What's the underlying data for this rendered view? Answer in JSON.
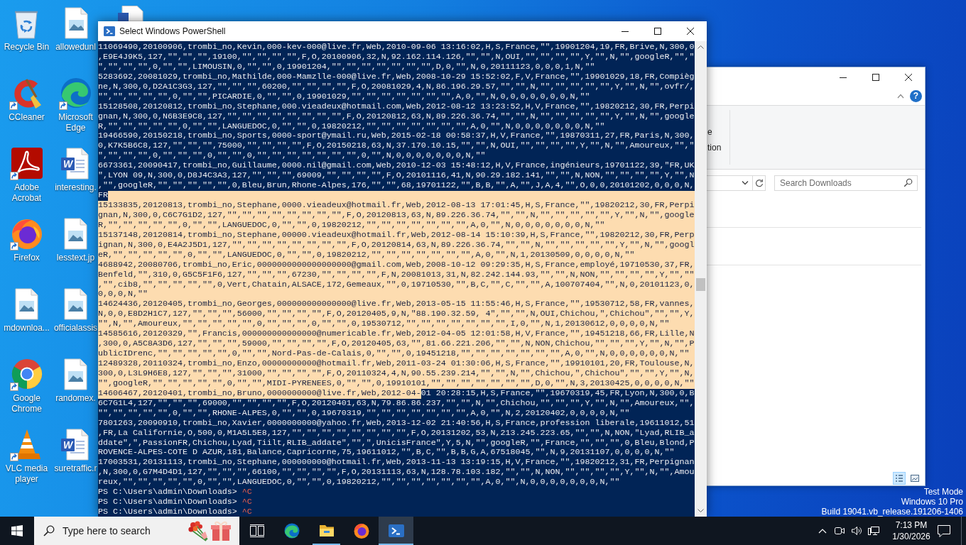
{
  "desktop": {
    "icons": [
      {
        "label": "Recycle Bin",
        "kind": "recycle-bin",
        "shortcut": false
      },
      {
        "label": "CCleaner",
        "kind": "ccleaner",
        "shortcut": true
      },
      {
        "label": "Adobe Acrobat",
        "kind": "acrobat",
        "shortcut": true
      },
      {
        "label": "Firefox",
        "kind": "firefox",
        "shortcut": true
      },
      {
        "label": "mdownloa...",
        "kind": "image",
        "shortcut": false
      },
      {
        "label": "Google Chrome",
        "kind": "chrome",
        "shortcut": true
      },
      {
        "label": "VLC media player",
        "kind": "vlc",
        "shortcut": true
      },
      {
        "label": "allowedunl",
        "kind": "image",
        "shortcut": false
      },
      {
        "label": "Microsoft Edge",
        "kind": "edge",
        "shortcut": true
      },
      {
        "label": "interesting.",
        "kind": "word",
        "logo_letter": "W",
        "shortcut": false
      },
      {
        "label": "lesstext.jp",
        "kind": "image",
        "shortcut": false
      },
      {
        "label": "officialassis",
        "kind": "image",
        "shortcut": false
      },
      {
        "label": "randomex.",
        "kind": "image",
        "shortcut": false
      },
      {
        "label": "suretraffic.r",
        "kind": "word",
        "logo_letter": "W",
        "shortcut": false
      }
    ]
  },
  "powershell": {
    "title": "Select Windows PowerShell",
    "rows": [
      {
        "kind": "output",
        "selected": false,
        "text": "11069490,20100906,trombi_no,Kevin,000-kev-000@live.fr,Web,2010-09-06 13:16:02,H,S,France,\"\",19901204,19,FR,Brive,N,300,0"
      },
      {
        "kind": "output",
        "selected": false,
        "text": ",E9E4J9K5,127,\"\",\"\",\"\",19100,\"\",\"\",\"\",\"\",F,O,20100906,32,N,92.162.114.126,\"\",\"\",N,OUI,\"\",\"\",\"\",\"\",Y,\"\",N,\"\",googleR,\"\",\""
      },
      {
        "kind": "output",
        "selected": false,
        "text": "\",\"\",\"\",\"\",0,\"\",\"\",LIMOUSIN,0,\"\",\"\",0,19901204,\"\",\"\",\"\",\"\",\"\",\"\",\"\",D,0,\"\",N,0,20111123,0,0,0,1,N,\"\""
      },
      {
        "kind": "output",
        "selected": false,
        "text": "5283692,20081029,trombi_no,Mathilde,000-Mamzlle-000@live.fr,Web,2008-10-29 15:52:02,F,V,France,\"\",19901029,18,FR,Compièg"
      },
      {
        "kind": "output",
        "selected": false,
        "text": "ne,N,300,0,D2A1C3G3,127,\"\",\"\",\"\",60200,\"\",\"\",\"\",\"\",F,O,20081029,4,N,86.196.29.57,\"\",\"\",N,\"\",\"\",\"\",\"\",\"\",Y,\"\",N,\"\",ovfr/,"
      },
      {
        "kind": "output",
        "selected": false,
        "text": "\"\",\"\",\"\",\"\",\"\",0,\"\",\"\",PICARDIE,0,\"\",\"\",0,19901029,\"\",\"\",\"\",\"\",\"\",\"\",\"\",A,0,\"\",N,0,0,0,0,0,0,0,N,\"\""
      },
      {
        "kind": "output",
        "selected": false,
        "text": "15128508,20120812,trombi_no,Stephane,000.vieadeux@hotmail.com,Web,2012-08-12 13:23:52,H,V,France,\"\",19820212,30,FR,Perpi"
      },
      {
        "kind": "output",
        "selected": false,
        "text": "gnan,N,300,0,N6B3E9C8,127,\"\",\"\",\"\",\"\",\"\",\"\",\"\",\"\",F,O,20120812,63,N,89.226.36.74,\"\",\"\",N,\"\",\"\",\"\",\"\",\"\",Y,\"\",N,\"\",google"
      },
      {
        "kind": "output",
        "selected": false,
        "text": "R,\"\",\"\",\"\",\"\",\"\",0,\"\",\"\",LANGUEDOC,0,\"\",\"\",0,19820212,\"\",\"\",\"\",\"\",\"\",\"\",\"\",A,0,\"\",N,0,0,0,0,0,0,0,N,\"\""
      },
      {
        "kind": "output",
        "selected": false,
        "text": "19466590,20150218,trombi_no,Sports,0000-sport@ymail.ru,Web,2015-02-18 00:58:37,H,V,France,\"\",19870311,27,FR,Paris,N,300,"
      },
      {
        "kind": "output",
        "selected": false,
        "text": "0,K7K5B6C8,127,\"\",\"\",\"\",75000,\"\",\"\",\"\",\"\",F,O,20150218,63,N,37.170.10.15,\"\",\"\",N,OUI,\"\",\"\",\"\",\"\",Y,\"\",N,\"\",Amoureux,\"\",\""
      },
      {
        "kind": "output",
        "selected": false,
        "text": "\",\"\",\"\",\"\",0,\"\",\"\",\"\",0,\"\",\"\",0,\"\",\"\",\"\",\"\",\"\",\"\",\"\",0,\"\",N,0,0,0,0,0,0,0,N,\"\""
      },
      {
        "kind": "output",
        "selected": false,
        "text": "6673361,20090417,trombi_no,Guillaume,0000.nil@gmail.com,Web,2010-12-03 15:48:12,H,V,France,ingénieurs,19701122,39,\"FR,UK"
      },
      {
        "kind": "output",
        "selected": false,
        "text": "\",LYON 09,N,300,0,D8J4C3A3,127,\"\",\"\",\"\",69009,\"\",\"\",\"\",\"\",F,O,20101116,41,N,90.29.182.141,\"\",\"\",N,NON,\"\",\"\",\"\",\"\",Y,\"\",N"
      },
      {
        "kind": "output",
        "selected": false,
        "text": ",\"\",googleR,\"\",\"\",\"\",\"\",\"\",0,Bleu,Brun,Rhone-Alpes,176,\"\",\"\",68,19701122,\"\",B,B,\"\",A,\"\",J,A,4,\"\",O,0,0,20101202,0,0,0,N,"
      },
      {
        "kind": "split",
        "segments": [
          {
            "text": "FR",
            "selected": false
          }
        ],
        "tail_selected": true
      },
      {
        "kind": "output",
        "selected": true,
        "text": "15133835,20120813,trombi_no,Stephane,0000.vieadeux@hotmail.fr,Web,2012-08-13 17:01:45,H,S,France,\"\",19820212,30,FR,Perpi"
      },
      {
        "kind": "output",
        "selected": true,
        "text": "gnan,N,300,0,C6C7G1D2,127,\"\",\"\",\"\",\"\",\"\",\"\",\"\",\"\",F,O,20120813,63,N,89.226.36.74,\"\",\"\",N,\"\",\"\",\"\",\"\",\"\",Y,\"\",N,\"\",google"
      },
      {
        "kind": "output",
        "selected": true,
        "text": "R,\"\",\"\",\"\",\"\",\"\",0,\"\",\"\",LANGUEDOC,0,\"\",\"\",0,19820212,\"\",\"\",\"\",\"\",\"\",\"\",\"\",A,0,\"\",N,0,0,0,0,0,0,0,N,\"\""
      },
      {
        "kind": "output",
        "selected": true,
        "text": "15137148,20120814,trombi_no,Stephane,00000.vieadeux@hotmail.fr,Web,2012-08-14 15:10:39,H,S,France,\"\",19820212,30,FR,Perp"
      },
      {
        "kind": "output",
        "selected": true,
        "text": "ignan,N,300,0,E4A2J5D1,127,\"\",\"\",\"\",\"\",\"\",\"\",\"\",\"\",F,O,20120814,63,N,89.226.36.74,\"\",\"\",N,\"\",\"\",\"\",\"\",\"\",Y,\"\",N,\"\",googl"
      },
      {
        "kind": "output",
        "selected": true,
        "text": "eR,\"\",\"\",\"\",\"\",\"\",0,\"\",\"\",LANGUEDOC,0,\"\",\"\",0,19820212,\"\",\"\",\"\",\"\",\"\",\"\",\"\",A,0,\"\",N,1,20130509,0,0,0,0,N,\"\""
      },
      {
        "kind": "output",
        "selected": true,
        "text": "4688942,20080706,trombi_no,Eric,0000000000000000000@gmail.com,Web,2008-10-12 09:29:35,H,S,France,employé,19710530,37,FR,"
      },
      {
        "kind": "output",
        "selected": true,
        "text": "Benfeld,\"\",310,0,G5C5F1F6,127,\"\",\"\",\"\",67230,\"\",\"\",\"\",\"\",F,N,20081013,31,N,82.242.144.93,\"\",\"\",N,NON,\"\",\"\",\"\",\"\",Y,\"\",\"\""
      },
      {
        "kind": "output",
        "selected": true,
        "text": ",\"\",cib8,\"\",\"\",\"\",\"\",\"\",0,Vert,Chatain,ALSACE,172,Gemeaux,\"\",0,19710530,\"\",B,C,\"\",C,\"\",\"\",A,100707404,\"\",N,0,20101123,0,"
      },
      {
        "kind": "output",
        "selected": true,
        "text": "0,0,0,N,\"\""
      },
      {
        "kind": "output",
        "selected": true,
        "text": "14624436,20120405,trombi_no,Georges,000000000000000@live.fr,Web,2013-05-15 11:55:46,H,S,France,\"\",19530712,58,FR,vannes,"
      },
      {
        "kind": "output",
        "selected": true,
        "text": "N,0,0,E8D2H1C7,127,\"\",\"\",\"\",56000,\"\",\"\",\"\",\"\",F,O,20120405,9,N,\"88.190.32.59, 4\",\"\",\"\",N,OUI,Chichou,\",Chichou\",\"\",\"\",Y,"
      },
      {
        "kind": "output",
        "selected": true,
        "text": "\"\",N,\"\",Amoureux,\"\",\"\",\"\",\"\",\"\",0,\"\",\"\",\"\",0,\"\",\"\",0,19530712,\"\",\"\",\"\",\"\",\"\",\"\",\"\",I,0,\"\",N,1,20130612,0,0,0,0,N,\"\""
      },
      {
        "kind": "output",
        "selected": true,
        "text": "14585616,20120329,\"\",Francis,000000000000000@numericable.fr,Web,2012-04-05 12:01:58,H,V,France,\"\",19451218,66,FR,Lille,N"
      },
      {
        "kind": "output",
        "selected": true,
        "text": ",300,0,A5C8A3D6,127,\"\",\"\",\"\",59000,\"\",\"\",\"\",\"\",F,O,20120405,63,\"\",81.66.221.206,\"\",\"\",N,NON,Chichou,\"\",\"\",\"\",Y,\"\",N,\"\",P"
      },
      {
        "kind": "output",
        "selected": true,
        "text": "ublicIDrenc,\"\",\"\",\"\",\"\",\"\",0,\"\",\"\",Nord-Pas-de-Calais,0,\"\",\"\",0,19451218,\"\",\"\",\"\",\"\",\"\",\"\",\"\",A,0,\"\",N,0,0,0,0,0,0,N,\"\""
      },
      {
        "kind": "output",
        "selected": true,
        "text": "12489328,20110324,trombi_no,Enzo,00000000000@hotmail.fr,Web,2011-03-24 01:30:06,H,S,France,\"\",19910101,20,FR,Toulouse,N,"
      },
      {
        "kind": "output",
        "selected": true,
        "text": "300,0,L3L9H6E8,127,\"\",\"\",\"\",31000,\"\",\"\",\"\",\"\",F,O,20110324,4,N,90.55.239.214,\"\",\"\",N,\"\",Chichou,\",Chichou\",\"\",\"\",Y,\"\",N,"
      },
      {
        "kind": "output",
        "selected": true,
        "text": "\"\",googleR,\"\",\"\",\"\",\"\",\"\",0,\"\",\"\",MIDI-PYRENEES,0,\"\",\"\",0,19910101,\"\",\"\",\"\",\"\",\"\",\"\",\"\",D,0,\"\",N,3,20130425,0,0,0,0,N,\"\""
      },
      {
        "kind": "split",
        "segments": [
          {
            "text": "14606467,20120401,trombi_no,Bruno,0000000000@live.fr,Web,2012-04-",
            "selected": true
          },
          {
            "text": "01 20:28:15,H,S,France,\"\",19670319,45,FR,Lyon,N,300,0,B",
            "selected": false
          }
        ],
        "tail_selected": false
      },
      {
        "kind": "output",
        "selected": false,
        "text": "6C7G1L4,127,\"\",\"\",\"\",69000,\"\",\"\",\"\",\"\",F,O,20120401,63,N,79.86.86.237,\"\",\"\",N,\"\",Chichou,\"\",\"\",\"\",Y,\"\",N,\"\",Amoureux,\"\","
      },
      {
        "kind": "output",
        "selected": false,
        "text": "\"\",\"\",\"\",\"\",\"\",0,\"\",\"\",RHONE-ALPES,0,\"\",\"\",0,19670319,\"\",\"\",\"\",\"\",\"\",\"\",\"\",A,0,\"\",N,2,20120402,0,0,0,0,N,\"\""
      },
      {
        "kind": "output",
        "selected": false,
        "text": "7801263,20090910,trombi_no,Xavier,0000000000@yahoo.fr,Web,2013-12-02 21:40:56,H,S,France,profession liberale,19611012,51"
      },
      {
        "kind": "output",
        "selected": false,
        "text": ",FR,La Californie,O,500,0,M1A5L5E8,127,\"\",\"\",\"\",\"\",\"\",\"\",\"\",\"\",F,O,20131202,53,N,213.245.223.65,\"\",\"\",N,NON,\"Lyad,RLIB_a"
      },
      {
        "kind": "output",
        "selected": false,
        "text": "ddate\",\",PassionFR,Chichou,Lyad,Tiilt,RLIB_addate\",\"\",\",UnicisFrance\",Y,5,N,\"\",googleR,\"\",France,\"\",\"\",\"\",0,Bleu,Blond,P"
      },
      {
        "kind": "output",
        "selected": false,
        "text": "ROVENCE-ALPES-COTE D AZUR,181,Balance,Capricorne,75,19611012,\"\",B,C,\"\",B,B,G,A,67518045,\"\",N,9,20131107,0,0,0,0,N,\"\""
      },
      {
        "kind": "output",
        "selected": false,
        "text": "17003531,20131113,trombi_no,Stephane,000000000@hotmail.fr,Web,2013-11-13 13:19:15,H,V,France,\"\",19820212,31,FR,Perpignan"
      },
      {
        "kind": "output",
        "selected": false,
        "text": ",N,300,0,G7M4D4D1,127,\"\",\"\",\"\",66100,\"\",\"\",\"\",\"\",F,O,20131113,63,N,128.78.103.182,\"\",\"\",N,NON,\"\",\"\",\"\",\"\",Y,\"\",N,\"\",Amou"
      },
      {
        "kind": "output",
        "selected": false,
        "text": "reux,\"\",\"\",\"\",\"\",\"\",0,\"\",\"\",LANGUEDOC,0,\"\",\"\",0,19820212,\"\",\"\",\"\",\"\",\"\",\"\",\"\",A,0,\"\",N,0,0,0,0,0,0,0,N,\"\""
      },
      {
        "kind": "prompt",
        "prompt": "PS C:\\Users\\admin\\Downloads>",
        "input": "^C"
      },
      {
        "kind": "prompt",
        "prompt": "PS C:\\Users\\admin\\Downloads>",
        "input": "^C"
      },
      {
        "kind": "prompt",
        "prompt": "PS C:\\Users\\admin\\Downloads>",
        "input": "^C"
      }
    ]
  },
  "explorer": {
    "ribbon_labels": [
      "e",
      "tion"
    ],
    "help_label": "?",
    "search": {
      "placeholder": "Search Downloads"
    },
    "views": [
      {
        "kind": "details",
        "selected": true
      },
      {
        "kind": "large-icons",
        "selected": false
      }
    ]
  },
  "system_notice": [
    "Test Mode",
    "Windows 10 Pro",
    "Build 19041.vb_release.191206-1406"
  ],
  "taskbar": {
    "search": {
      "placeholder": "Type here to search"
    },
    "apps": [
      {
        "kind": "task-view",
        "selected": false,
        "running": false
      },
      {
        "kind": "edge",
        "selected": false,
        "running": false
      },
      {
        "kind": "file-explorer",
        "selected": false,
        "running": true
      },
      {
        "kind": "firefox",
        "selected": false,
        "running": false
      },
      {
        "kind": "powershell",
        "selected": true,
        "running": true
      }
    ],
    "clock": {
      "time": "7:13 PM",
      "date": "1/30/2026"
    }
  }
}
